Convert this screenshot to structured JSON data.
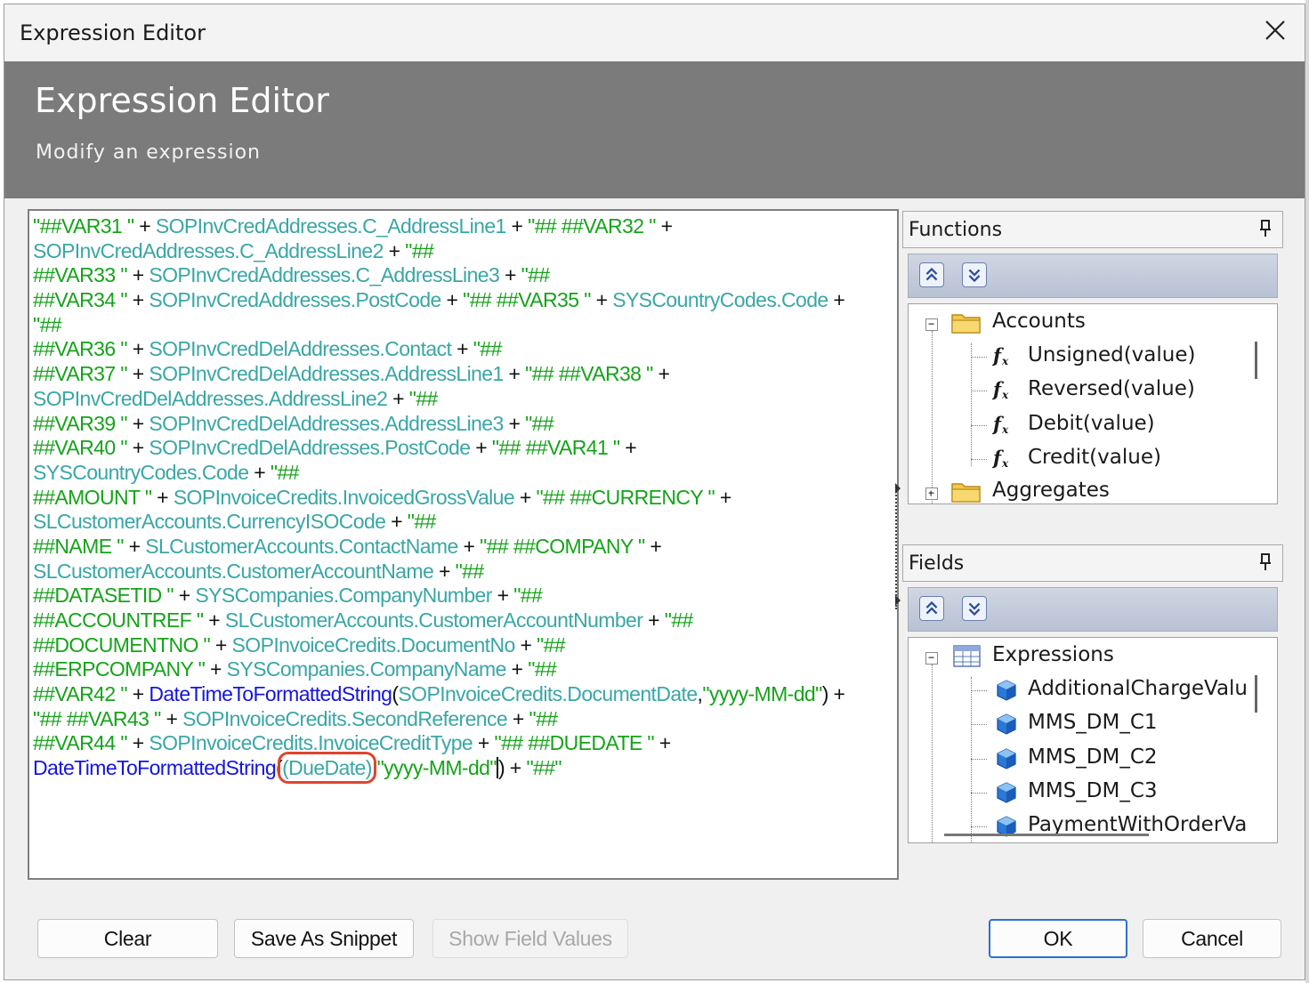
{
  "window": {
    "title": "Expression Editor"
  },
  "banner": {
    "title": "Expression Editor",
    "subtitle": "Modify an expression"
  },
  "editor": {
    "lines": [
      [
        [
          "str",
          "\"##VAR31 \""
        ],
        [
          "op",
          " + "
        ],
        [
          "fld",
          "SOPInvCredAddresses.C_AddressLine1"
        ],
        [
          "op",
          " + "
        ],
        [
          "str",
          "\"## ##VAR32 \""
        ],
        [
          "op",
          " +"
        ]
      ],
      [
        [
          "fld",
          "SOPInvCredAddresses.C_AddressLine2"
        ],
        [
          "op",
          " + "
        ],
        [
          "str",
          "\"##"
        ]
      ],
      [
        [
          "str",
          "##VAR33 \""
        ],
        [
          "op",
          " + "
        ],
        [
          "fld",
          "SOPInvCredAddresses.C_AddressLine3"
        ],
        [
          "op",
          " + "
        ],
        [
          "str",
          "\"##"
        ]
      ],
      [
        [
          "str",
          "##VAR34 \""
        ],
        [
          "op",
          " + "
        ],
        [
          "fld",
          "SOPInvCredAddresses.PostCode"
        ],
        [
          "op",
          " + "
        ],
        [
          "str",
          "\"## ##VAR35 \""
        ],
        [
          "op",
          " + "
        ],
        [
          "fld",
          "SYSCountryCodes.Code"
        ],
        [
          "op",
          " +"
        ]
      ],
      [
        [
          "str",
          "\"##"
        ]
      ],
      [
        [
          "str",
          "##VAR36 \""
        ],
        [
          "op",
          " + "
        ],
        [
          "fld",
          "SOPInvCredDelAddresses.Contact"
        ],
        [
          "op",
          " + "
        ],
        [
          "str",
          "\"##"
        ]
      ],
      [
        [
          "str",
          "##VAR37 \""
        ],
        [
          "op",
          " + "
        ],
        [
          "fld",
          "SOPInvCredDelAddresses.AddressLine1"
        ],
        [
          "op",
          " + "
        ],
        [
          "str",
          "\"## ##VAR38 \""
        ],
        [
          "op",
          " +"
        ]
      ],
      [
        [
          "fld",
          "SOPInvCredDelAddresses.AddressLine2"
        ],
        [
          "op",
          " + "
        ],
        [
          "str",
          "\"##"
        ]
      ],
      [
        [
          "str",
          "##VAR39 \""
        ],
        [
          "op",
          " + "
        ],
        [
          "fld",
          "SOPInvCredDelAddresses.AddressLine3"
        ],
        [
          "op",
          " + "
        ],
        [
          "str",
          "\"##"
        ]
      ],
      [
        [
          "str",
          "##VAR40 \""
        ],
        [
          "op",
          " + "
        ],
        [
          "fld",
          "SOPInvCredDelAddresses.PostCode"
        ],
        [
          "op",
          " + "
        ],
        [
          "str",
          "\"## ##VAR41 \""
        ],
        [
          "op",
          " +"
        ]
      ],
      [
        [
          "fld",
          "SYSCountryCodes.Code"
        ],
        [
          "op",
          " + "
        ],
        [
          "str",
          "\"##"
        ]
      ],
      [
        [
          "str",
          "##AMOUNT \""
        ],
        [
          "op",
          " + "
        ],
        [
          "fld",
          "SOPInvoiceCredits.InvoicedGrossValue"
        ],
        [
          "op",
          " + "
        ],
        [
          "str",
          "\"## ##CURRENCY \""
        ],
        [
          "op",
          " +"
        ]
      ],
      [
        [
          "fld",
          "SLCustomerAccounts.CurrencyISOCode"
        ],
        [
          "op",
          " + "
        ],
        [
          "str",
          "\"##"
        ]
      ],
      [
        [
          "str",
          "##NAME \""
        ],
        [
          "op",
          " + "
        ],
        [
          "fld",
          "SLCustomerAccounts.ContactName"
        ],
        [
          "op",
          " + "
        ],
        [
          "str",
          "\"## ##COMPANY \""
        ],
        [
          "op",
          " +"
        ]
      ],
      [
        [
          "fld",
          "SLCustomerAccounts.CustomerAccountName"
        ],
        [
          "op",
          " + "
        ],
        [
          "str",
          "\"##"
        ]
      ],
      [
        [
          "str",
          "##DATASETID \""
        ],
        [
          "op",
          " + "
        ],
        [
          "fld",
          "SYSCompanies.CompanyNumber"
        ],
        [
          "op",
          " + "
        ],
        [
          "str",
          "\"##"
        ]
      ],
      [
        [
          "str",
          "##ACCOUNTREF \""
        ],
        [
          "op",
          " + "
        ],
        [
          "fld",
          "SLCustomerAccounts.CustomerAccountNumber"
        ],
        [
          "op",
          " + "
        ],
        [
          "str",
          "\"##"
        ]
      ],
      [
        [
          "str",
          "##DOCUMENTNO \""
        ],
        [
          "op",
          " + "
        ],
        [
          "fld",
          "SOPInvoiceCredits.DocumentNo"
        ],
        [
          "op",
          " + "
        ],
        [
          "str",
          "\"##"
        ]
      ],
      [
        [
          "str",
          "##ERPCOMPANY \""
        ],
        [
          "op",
          " + "
        ],
        [
          "fld",
          "SYSCompanies.CompanyName"
        ],
        [
          "op",
          " + "
        ],
        [
          "str",
          "\"##"
        ]
      ],
      [
        [
          "str",
          "##VAR42 \""
        ],
        [
          "op",
          " + "
        ],
        [
          "fn",
          "DateTimeToFormattedString"
        ],
        [
          "op",
          "("
        ],
        [
          "fld",
          "SOPInvoiceCredits.DocumentDate"
        ],
        [
          "op",
          ","
        ],
        [
          "str",
          "\"yyyy-MM-dd\""
        ],
        [
          "op",
          ") +"
        ]
      ],
      [
        [
          "str",
          "\"## ##VAR43 \""
        ],
        [
          "op",
          " + "
        ],
        [
          "fld",
          "SOPInvoiceCredits.SecondReference"
        ],
        [
          "op",
          " + "
        ],
        [
          "str",
          "\"##"
        ]
      ],
      [
        [
          "str",
          "##VAR44 \""
        ],
        [
          "op",
          " + "
        ],
        [
          "fld",
          "SOPInvoiceCredits.InvoiceCreditType"
        ],
        [
          "op",
          " + "
        ],
        [
          "str",
          "\"## ##DUEDATE \""
        ],
        [
          "op",
          " +"
        ]
      ],
      [
        [
          "fn",
          "DateTimeToFormattedString"
        ],
        [
          "op",
          "("
        ],
        [
          "fld",
          "(DueDate)",
          "hl"
        ],
        [
          "op",
          ","
        ],
        [
          "str",
          "\"yyyy-MM-dd\""
        ],
        [
          "caret",
          ""
        ],
        [
          "op",
          ") + "
        ],
        [
          "str",
          "\"##\""
        ]
      ]
    ]
  },
  "functions_panel": {
    "title": "Functions",
    "tree": {
      "group": "Accounts",
      "items": [
        "Unsigned(value)",
        "Reversed(value)",
        "Debit(value)",
        "Credit(value)"
      ],
      "next_group": "Aggregates"
    }
  },
  "fields_panel": {
    "title": "Fields",
    "tree": {
      "group": "Expressions",
      "items": [
        "AdditionalChargeValu",
        "MMS_DM_C1",
        "MMS_DM_C2",
        "MMS_DM_C3",
        "PaymentWithOrderVa"
      ]
    }
  },
  "buttons": {
    "clear": "Clear",
    "save_snippet": "Save As Snippet",
    "show_field_values": "Show Field Values",
    "ok": "OK",
    "cancel": "Cancel"
  },
  "icons": {
    "close": "close-icon",
    "pin": "pin-icon",
    "collapse_all": "collapse-all-icon",
    "expand_all": "expand-all-icon",
    "folder": "folder-icon",
    "function": "function-icon",
    "table": "table-icon",
    "field": "field-icon"
  },
  "colors": {
    "string_literal": "#15a31a",
    "field_reference": "#3aa6a6",
    "function_name": "#1414e0",
    "highlight_box": "#e0442e",
    "banner": "#7b7b7b",
    "ok_border": "#2f6fd0"
  }
}
